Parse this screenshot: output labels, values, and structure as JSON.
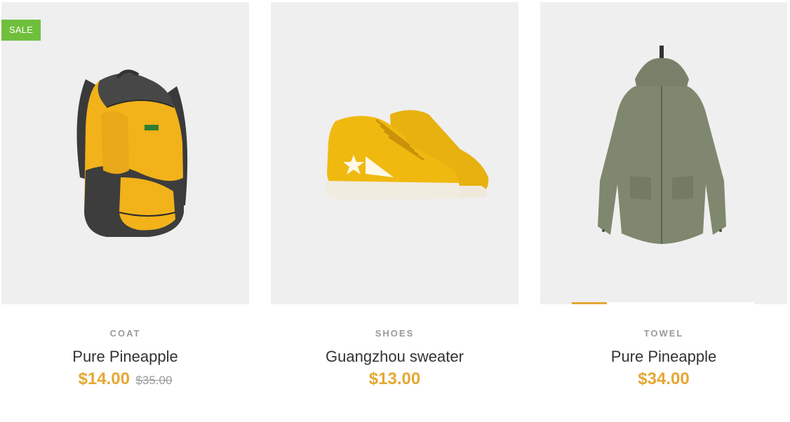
{
  "products": [
    {
      "category": "COAT",
      "name": "Pure Pineapple",
      "price": "$14.00",
      "old_price": "$35.00",
      "badge": "SALE",
      "image_icon": "backpack-icon"
    },
    {
      "category": "SHOES",
      "name": "Guangzhou sweater",
      "price": "$13.00",
      "image_icon": "sneakers-icon"
    },
    {
      "category": "TOWEL",
      "name": "Pure Pineapple",
      "price": "$34.00",
      "image_icon": "jacket-icon"
    }
  ],
  "colors": {
    "accent": "#e5a833",
    "sale": "#6fbf3d",
    "card_bg": "#efefef"
  }
}
